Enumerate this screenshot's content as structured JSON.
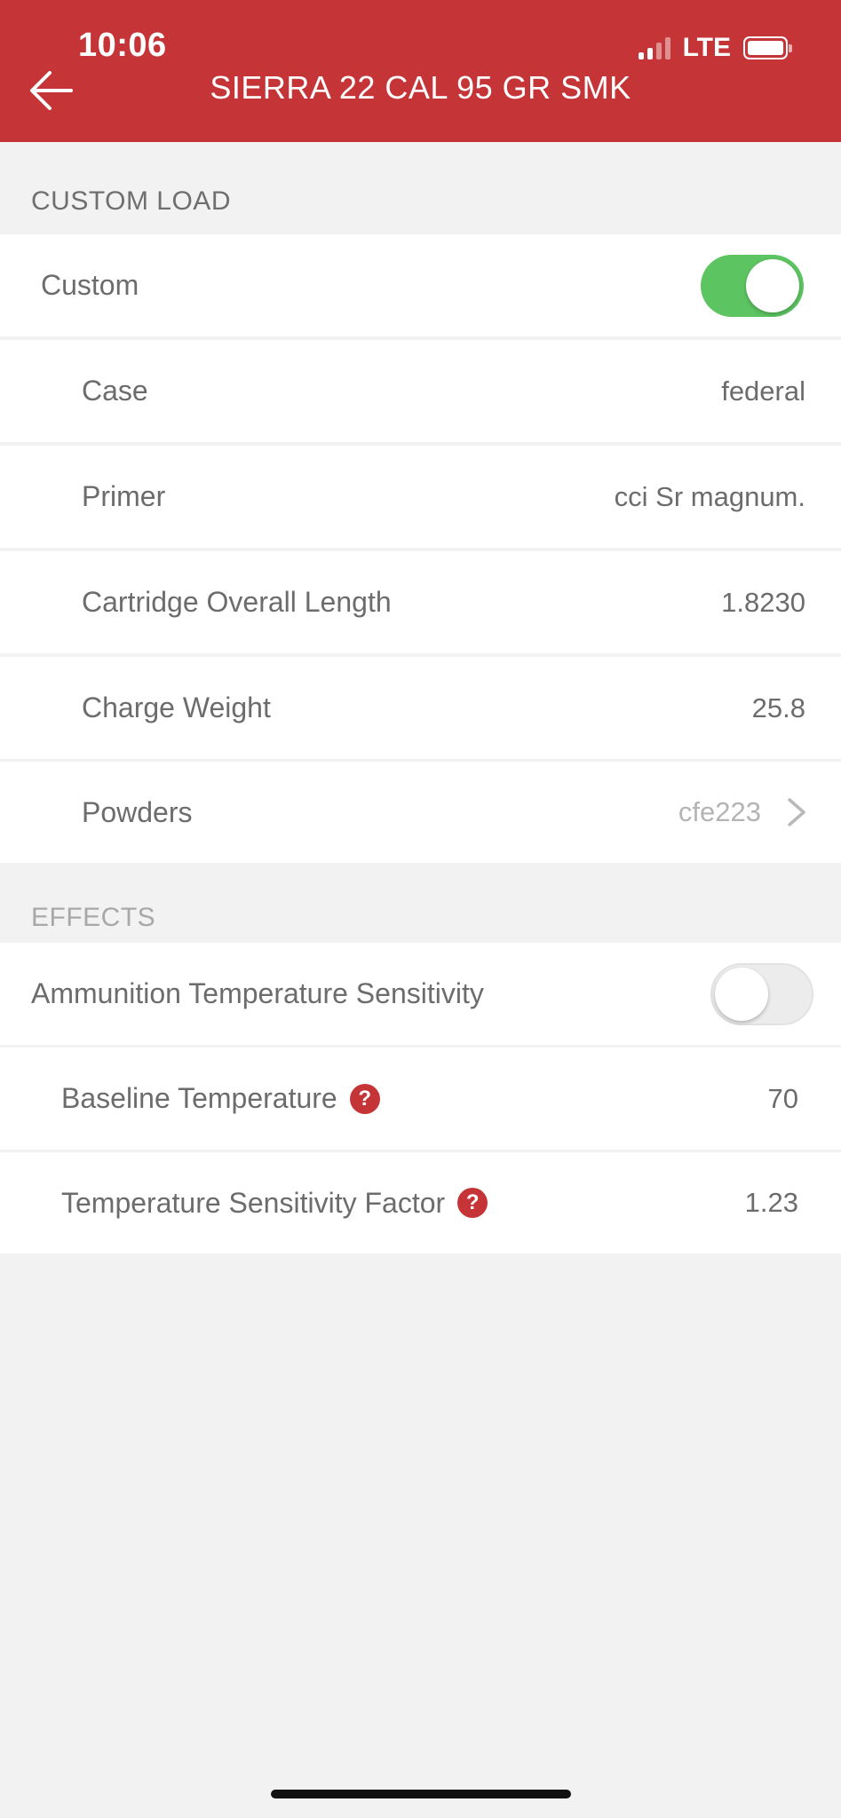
{
  "status_bar": {
    "time": "10:06",
    "network": "LTE"
  },
  "header": {
    "title": "SIERRA 22 CAL 95 GR SMK",
    "back_icon": "arrow-left-icon"
  },
  "colors": {
    "header_bg": "#c53538",
    "toggle_on": "#5cc460",
    "help_icon": "#c53538",
    "page_bg": "#f2f2f2"
  },
  "custom_load": {
    "section_label": "CUSTOM LOAD",
    "custom_label": "Custom",
    "custom_enabled": true,
    "fields": [
      {
        "label": "Case",
        "value": "federal"
      },
      {
        "label": "Primer",
        "value": "cci Sr magnum."
      },
      {
        "label": "Cartridge Overall Length",
        "value": "1.8230"
      },
      {
        "label": "Charge Weight",
        "value": "25.8"
      },
      {
        "label": "Powders",
        "value": "cfe223"
      }
    ]
  },
  "effects": {
    "section_label": "EFFECTS",
    "temp_sensitivity_label": "Ammunition Temperature Sensitivity",
    "temp_sensitivity_enabled": false,
    "baseline_label": "Baseline Temperature",
    "baseline_value": "70",
    "factor_label": "Temperature Sensitivity Factor",
    "factor_value": "1.23",
    "help_icon_glyph": "?"
  }
}
